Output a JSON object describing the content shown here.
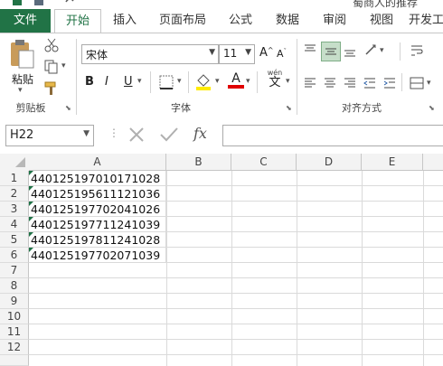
{
  "window": {
    "title_partial": "蜀商人的推荐"
  },
  "tabs": {
    "file": "文件",
    "home": "开始",
    "insert": "插入",
    "page_layout": "页面布局",
    "formulas": "公式",
    "data": "数据",
    "review": "审阅",
    "view": "视图",
    "developer": "开发工"
  },
  "clipboard": {
    "paste": "粘贴",
    "group_label": "剪贴板"
  },
  "font": {
    "name": "宋体",
    "size": "11",
    "bold": "B",
    "italic": "I",
    "underline": "U",
    "font_color_letter": "A",
    "phonetic": "wén",
    "phonetic_char": "文",
    "grow": "A",
    "shrink": "A",
    "group_label": "字体"
  },
  "alignment": {
    "group_label": "对齐方式"
  },
  "formula_bar": {
    "name_box": "H22",
    "fx": "fx",
    "value": ""
  },
  "sheet": {
    "columns": [
      "A",
      "B",
      "C",
      "D",
      "E"
    ],
    "rows": [
      "1",
      "2",
      "3",
      "4",
      "5",
      "6",
      "7",
      "8",
      "9",
      "10",
      "11",
      "12"
    ],
    "cells_A": [
      "440125197010171028",
      "440125195611121036",
      "440125197702041026",
      "440125197711241039",
      "440125197811241028",
      "440125197702071039"
    ]
  },
  "colors": {
    "accent": "#217346",
    "font_color_bar": "#e00000",
    "fill_color_bar": "#ffeb00"
  }
}
